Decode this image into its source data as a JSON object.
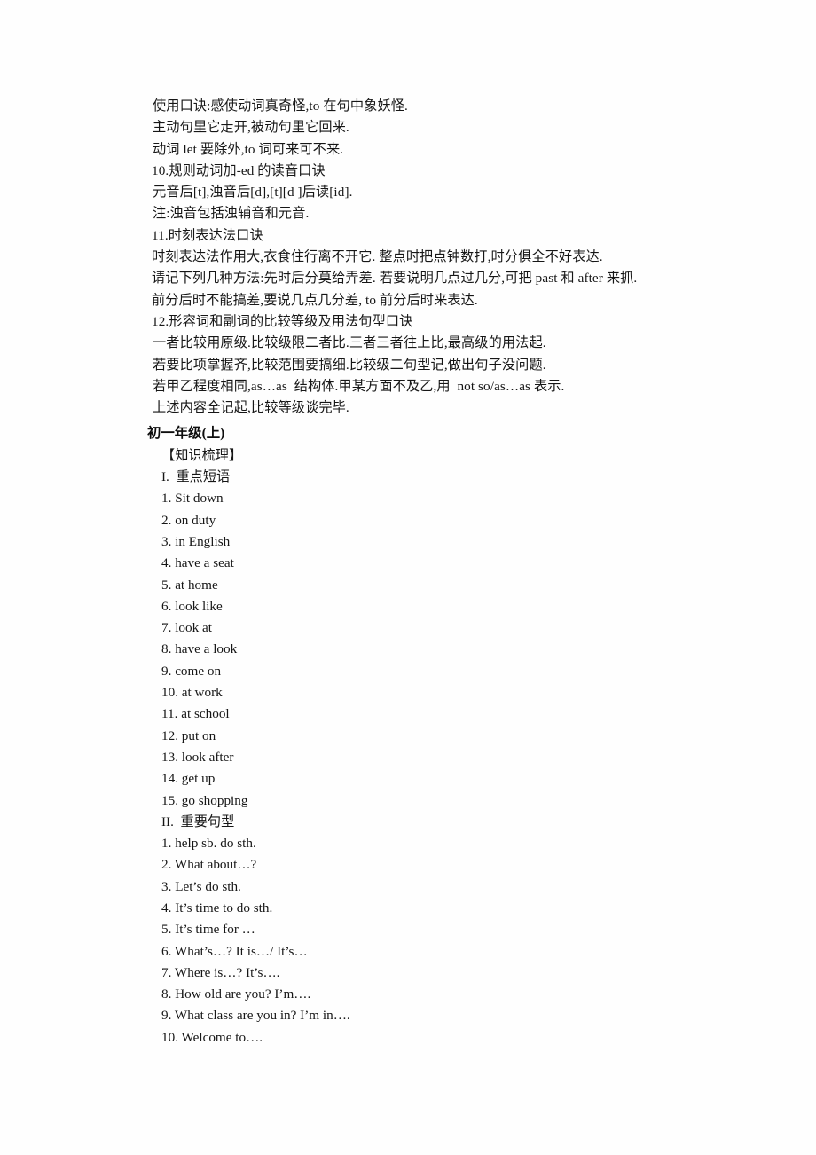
{
  "document": {
    "mnemonics_block": [
      {
        "id": "line-1",
        "text": "使用口诀:感使动词真奇怪,to 在句中象妖怪."
      },
      {
        "id": "line-2",
        "text": "主动句里它走开,被动句里它回来."
      },
      {
        "id": "line-3",
        "text": "动词 let 要除外,to 词可来可不来."
      },
      {
        "id": "line-4",
        "text": "10.规则动词加-ed 的读音口诀"
      },
      {
        "id": "line-5",
        "text": "元音后[t],浊音后[d],[t][d ]后读[id]."
      },
      {
        "id": "line-6",
        "text": "注:浊音包括浊辅音和元音."
      },
      {
        "id": "line-7",
        "text": "11.时刻表达法口诀"
      },
      {
        "id": "line-8",
        "text": "时刻表达法作用大,衣食住行离不开它. 整点时把点钟数打,时分俱全不好表达."
      },
      {
        "id": "line-9",
        "text": "请记下列几种方法:先时后分莫给弄差. 若要说明几点过几分,可把 past 和 after 来抓."
      },
      {
        "id": "line-10",
        "text": "前分后时不能搞差,要说几点几分差, to 前分后时来表达."
      },
      {
        "id": "line-11",
        "text": "12.形容词和副词的比较等级及用法句型口诀"
      },
      {
        "id": "line-12",
        "text": "一者比较用原级.比较级限二者比.三者三者往上比,最高级的用法起."
      },
      {
        "id": "line-13",
        "text": "若要比项掌握齐,比较范围要搞细.比较级二句型记,做出句子没问题."
      },
      {
        "id": "line-14",
        "text": "若甲乙程度相同,as…as  结构体.甲某方面不及乙,用  not so/as…as 表示."
      },
      {
        "id": "line-15",
        "text": "上述内容全记起,比较等级谈完毕."
      }
    ],
    "grade_heading": "初一年级(上)",
    "bracket_heading": "【知识梳理】",
    "sections": [
      {
        "id": "section-phrases",
        "heading": "I.  重点短语",
        "items": [
          "1. Sit down",
          "2. on duty",
          "3. in English",
          "4. have a seat",
          "5. at home",
          "6. look like",
          "7. look at",
          "8. have a look",
          "9. come on",
          "10. at work",
          "11. at school",
          "12. put on",
          "13. look after",
          "14. get up",
          "15. go shopping"
        ]
      },
      {
        "id": "section-sentence-patterns",
        "heading": "II.  重要句型",
        "items": [
          "1. help sb. do sth.",
          "2. What about…?",
          "3. Let’s do sth.",
          "4. It’s time to do sth.",
          "5. It’s time for …",
          "6. What’s…? It is…/ It’s…",
          "7. Where is…? It’s….",
          "8. How old are you? I’m….",
          "9. What class are you in? I’m in….",
          "10. Welcome to…."
        ]
      }
    ]
  }
}
